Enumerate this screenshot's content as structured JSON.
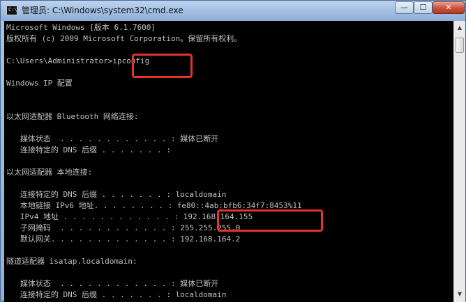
{
  "window": {
    "title": "管理员: C:\\Windows\\system32\\cmd.exe",
    "icon_text": "C:\\",
    "controls": {
      "minimize": "—",
      "maximize": "☐",
      "close": "✕"
    }
  },
  "colors": {
    "console_bg": "#000000",
    "console_text": "#c0c0c0",
    "highlight": "#e5322b"
  },
  "console": {
    "lines": [
      "Microsoft Windows [版本 6.1.7600]",
      "版权所有 (c) 2009 Microsoft Corporation。保留所有权利。",
      "",
      "C:\\Users\\Administrator>ipconfig",
      "",
      "Windows IP 配置",
      "",
      "",
      "以太网适配器 Bluetooth 网络连接:",
      "",
      "   媒体状态  . . . . . . . . . . . . : 媒体已断开",
      "   连接特定的 DNS 后缀 . . . . . . . :",
      "",
      "以太网适配器 本地连接:",
      "",
      "   连接特定的 DNS 后缀 . . . . . . . : localdomain",
      "   本地链接 IPv6 地址. . . . . . . . : fe80::4ab:bfb6:34f7:8453%11",
      "   IPv4 地址 . . . . . . . . . . . . : 192.168.164.155",
      "   子网掩码  . . . . . . . . . . . . : 255.255.255.0",
      "   默认网关. . . . . . . . . . . . . : 192.168.164.2",
      "",
      "隧道适配器 isatap.localdomain:",
      "",
      "   媒体状态  . . . . . . . . . . . . : 媒体已断开",
      "   连接特定的 DNS 后缀 . . . . . . . : localdomain"
    ]
  },
  "scrollbar": {
    "up_arrow": "▲",
    "down_arrow": "▼"
  }
}
